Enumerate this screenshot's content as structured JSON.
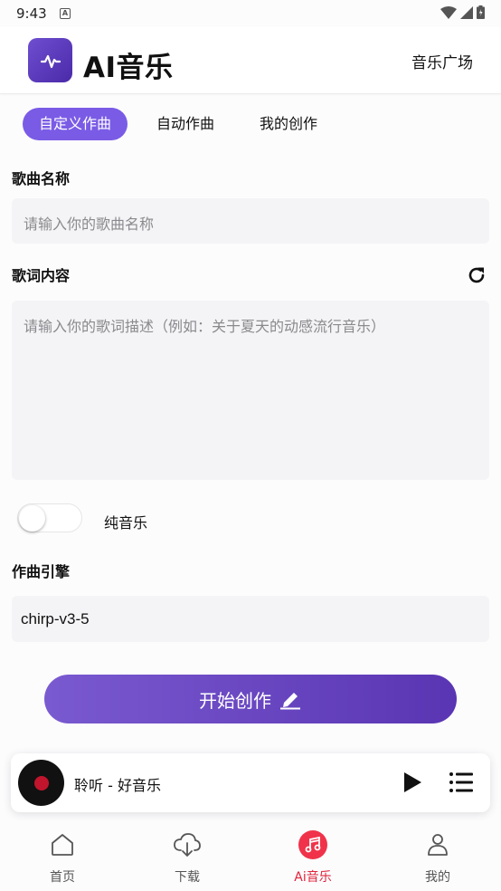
{
  "status": {
    "time": "9:43",
    "indicator": "A"
  },
  "header": {
    "title": "AI音乐",
    "link": "音乐广场"
  },
  "tabs": [
    {
      "label": "自定义作曲",
      "active": true
    },
    {
      "label": "自动作曲",
      "active": false
    },
    {
      "label": "我的创作",
      "active": false
    }
  ],
  "song_name": {
    "label": "歌曲名称",
    "placeholder": "请输入你的歌曲名称"
  },
  "lyrics": {
    "label": "歌词内容",
    "placeholder": "请输入你的歌词描述（例如：关于夏天的动感流行音乐）"
  },
  "pure_music": {
    "label": "纯音乐",
    "enabled": false
  },
  "engine": {
    "label": "作曲引擎",
    "value": "chirp-v3-5"
  },
  "create_button": {
    "label": "开始创作"
  },
  "player": {
    "title": "聆听 - 好音乐"
  },
  "nav": [
    {
      "label": "首页",
      "icon": "home-icon",
      "active": false
    },
    {
      "label": "下载",
      "icon": "download-cloud-icon",
      "active": false
    },
    {
      "label": "Ai音乐",
      "icon": "music-note-icon",
      "active": true
    },
    {
      "label": "我的",
      "icon": "person-icon",
      "active": false
    }
  ],
  "colors": {
    "accent": "#7a5be6",
    "button_gradient_start": "#7a5ad0",
    "button_gradient_end": "#5a35b3",
    "nav_active": "#e0243c"
  }
}
